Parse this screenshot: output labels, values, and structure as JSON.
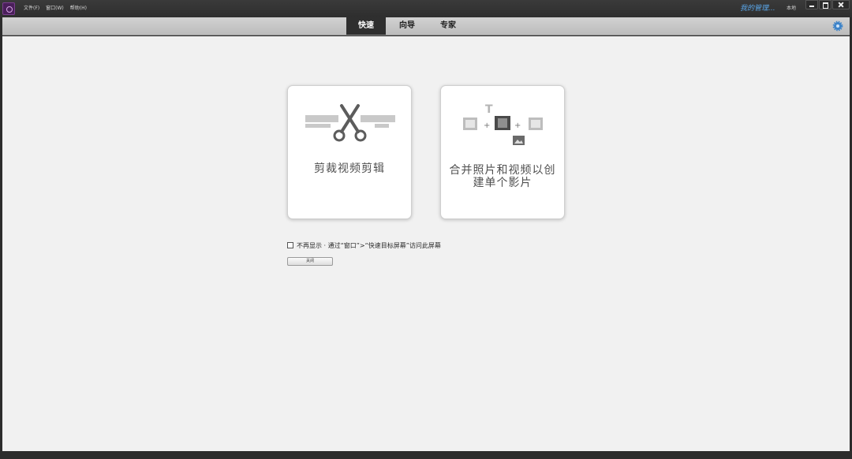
{
  "titlebar": {
    "menu": [
      "文件(F)",
      "窗口(W)",
      "帮助(H)"
    ],
    "my_computer": "我的管理...",
    "mini_label": "本地"
  },
  "modes": [
    "快速",
    "向导",
    "专家"
  ],
  "active_mode": "快速",
  "cards": [
    {
      "label": "剪裁视频剪辑",
      "icon": "scissors-trim-icon"
    },
    {
      "label_line1": "合并照片和视频以创",
      "label_line2": "建单个影片",
      "icon": "merge-media-icon"
    }
  ],
  "dont_show": {
    "checked": false,
    "text": "不再显示 · 通过“窗口”>“快速目标屏幕”访问此屏幕"
  },
  "close_button": "关闭",
  "colors": {
    "active_tab": "#2f2f2f",
    "accent_blue": "#5aa6e8",
    "graphic_gray": "#8a8a8a"
  }
}
